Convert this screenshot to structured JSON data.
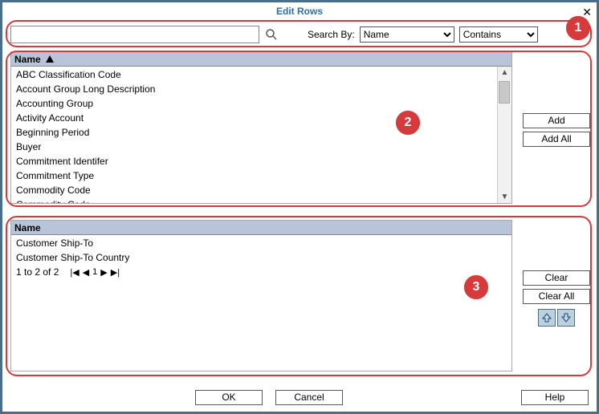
{
  "title": "Edit Rows",
  "close_label": "✕",
  "search": {
    "value": "",
    "placeholder": "",
    "label": "Search By:",
    "field": "Name",
    "mode": "Contains"
  },
  "available": {
    "header": "Name",
    "items": [
      "ABC Classification Code",
      "Account Group Long Description",
      "Accounting Group",
      "Activity Account",
      "Beginning Period",
      "Buyer",
      "Commitment Identifer",
      "Commitment Type",
      "Commodity Code",
      "Commodity Code"
    ]
  },
  "selected": {
    "header": "Name",
    "items": [
      "Customer Ship-To",
      "Customer Ship-To Country"
    ],
    "pager": {
      "text": "1 to 2 of 2",
      "page": "1"
    }
  },
  "buttons": {
    "add": "Add",
    "add_all": "Add All",
    "clear": "Clear",
    "clear_all": "Clear All",
    "ok": "OK",
    "cancel": "Cancel",
    "help": "Help"
  },
  "callouts": {
    "one": "1",
    "two": "2",
    "three": "3"
  }
}
